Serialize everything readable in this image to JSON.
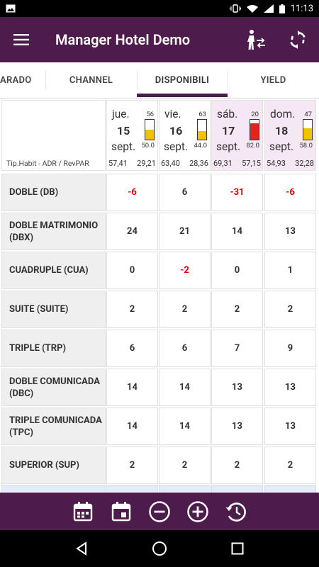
{
  "status_bar": {
    "time": "11:13",
    "icons": [
      "image-icon",
      "vibrate-icon",
      "wifi-icon",
      "signal-icon",
      "battery-icon"
    ]
  },
  "app_bar": {
    "title": "Manager Hotel Demo",
    "color": "#4d1b4c",
    "actions": [
      "hotel-staff-icon",
      "refresh-icon"
    ]
  },
  "tabs": [
    {
      "label": "ARADO"
    },
    {
      "label": "CHANNEL"
    },
    {
      "label": "DISPONIBILI"
    },
    {
      "label": "YIELD"
    }
  ],
  "active_tab": "DISPONIBILI",
  "grid": {
    "corner_label": "Tip.Habit - ADR / RevPAR",
    "days": [
      {
        "weekday": "jue.",
        "day": "15",
        "month": "sept.",
        "occ_top": "56",
        "occ_bottom": "50.0",
        "level": 0.5,
        "bar_color": "#f2c100",
        "adr": "57,41",
        "revpar": "29,21",
        "weekend": false
      },
      {
        "weekday": "vie.",
        "day": "16",
        "month": "sept.",
        "occ_top": "63",
        "occ_bottom": "44.0",
        "level": 0.44,
        "bar_color": "#f2c100",
        "adr": "63,40",
        "revpar": "28,36",
        "weekend": false
      },
      {
        "weekday": "sáb.",
        "day": "17",
        "month": "sept.",
        "occ_top": "20",
        "occ_bottom": "82.0",
        "level": 0.82,
        "bar_color": "#e42222",
        "adr": "69,31",
        "revpar": "57,15",
        "weekend": true
      },
      {
        "weekday": "dom.",
        "day": "18",
        "month": "sept.",
        "occ_top": "47",
        "occ_bottom": "58.0",
        "level": 0.58,
        "bar_color": "#f2c100",
        "adr": "54,93",
        "revpar": "32,28",
        "weekend": true
      }
    ],
    "rows": [
      {
        "label": "DOBLE (DB)",
        "values": [
          "-6",
          "6",
          "-31",
          "-6"
        ]
      },
      {
        "label": "DOBLE MATRIMONIO (DBX)",
        "values": [
          "24",
          "21",
          "14",
          "13"
        ]
      },
      {
        "label": "CUADRUPLE (CUA)",
        "values": [
          "0",
          "-2",
          "0",
          "1"
        ]
      },
      {
        "label": "SUITE (SUITE)",
        "values": [
          "2",
          "2",
          "2",
          "2"
        ]
      },
      {
        "label": "TRIPLE (TRP)",
        "values": [
          "6",
          "6",
          "7",
          "9"
        ]
      },
      {
        "label": "DOBLE COMUNICADA (DBC)",
        "values": [
          "14",
          "14",
          "13",
          "13"
        ]
      },
      {
        "label": "TRIPLE COMUNICADA (TPC)",
        "values": [
          "14",
          "14",
          "13",
          "13"
        ]
      },
      {
        "label": "SUPERIOR (SUP)",
        "values": [
          "2",
          "2",
          "2",
          "2"
        ]
      }
    ],
    "negative_color": "#e00000"
  },
  "bottom_bar": {
    "actions": [
      "calendar-range-icon",
      "calendar-icon",
      "zoom-out-icon",
      "zoom-in-icon",
      "history-icon"
    ]
  },
  "nav_bar": {
    "buttons": [
      "back-icon",
      "home-icon",
      "recents-icon"
    ]
  }
}
